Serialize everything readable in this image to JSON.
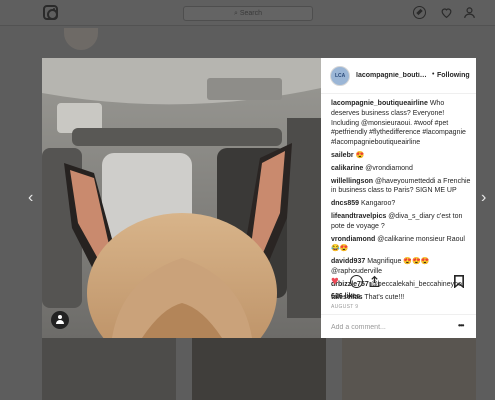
{
  "topbar": {
    "search_placeholder": "Search",
    "icons": [
      "instagram-logo",
      "compass-icon",
      "heart-icon",
      "profile-icon"
    ]
  },
  "post": {
    "username": "lacompagnie_boutiqueairline",
    "username_display": "lacompagnie_boutiqu...",
    "follow_dot": "•",
    "follow_label": "Following",
    "avatar_text": "LCA",
    "caption": {
      "user": "lacompagnie_boutiqueairline",
      "text": "Who deserves business class? Everyone! Including @monsieuraoui. #woof #pet #petfriendly #flythedifference #lacompagnie #lacompagnieboutiqueairline"
    },
    "comments": [
      {
        "user": "sailebr",
        "text": "😍"
      },
      {
        "user": "calikarine",
        "text": "@vrondiamond"
      },
      {
        "user": "willellingson",
        "text": "@haveyoumetteddi a Frenchie in business class to Paris? SIGN ME UP"
      },
      {
        "user": "dncs859",
        "text": "Kangaroo?"
      },
      {
        "user": "lifeandtravelpics",
        "text": "@diva_s_diary c'est ton pote de voyage ?"
      },
      {
        "user": "vrondiamond",
        "text": "@calikarine monsieur Raoul 😂😍"
      },
      {
        "user": "davidd937",
        "text": "Magnifique 😍😍😍 @raphouderville"
      },
      {
        "user": "drbizzle757",
        "text": "@beccalekahi_beccahineyho"
      },
      {
        "user": "taleselias",
        "text": "That's cute!!!"
      }
    ],
    "likes": "616 likes",
    "date": "AUGUST 9",
    "add_comment_placeholder": "Add a comment...",
    "more_label": "•••"
  },
  "colors": {
    "like_red": "#ed4956",
    "text_dark": "#262626",
    "muted": "#999999"
  }
}
